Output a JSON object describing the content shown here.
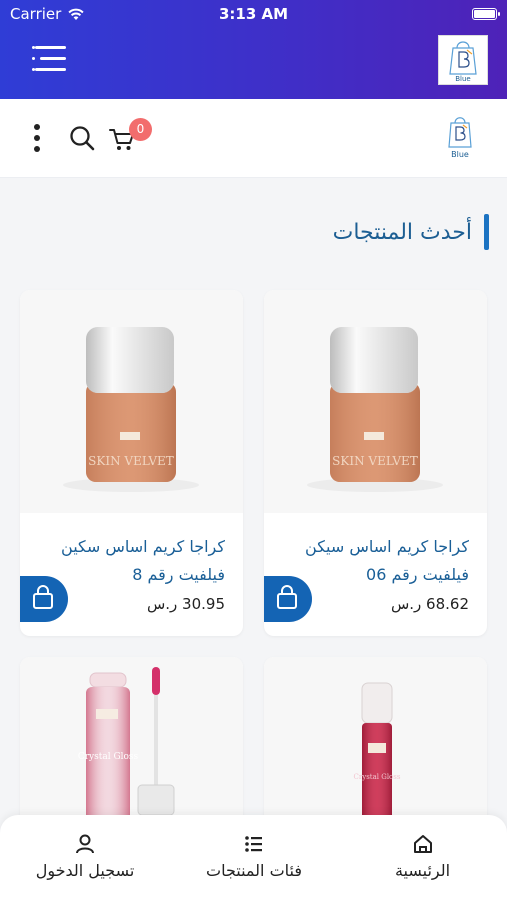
{
  "status_bar": {
    "carrier": "Carrier",
    "time": "3:13 AM"
  },
  "app_bar": {
    "logo_text": "Blue"
  },
  "header": {
    "cart_count": "0",
    "logo_text": "Blue"
  },
  "section": {
    "title": "أحدث المنتجات"
  },
  "products": [
    {
      "name": "كراجا كريم اساس سيكن فيلفيت رقم 06",
      "price": "68.62 ر.س",
      "jar_label": "SKIN VELVET"
    },
    {
      "name": "كراجا كريم اساس سكين فيلفيت رقم 8",
      "price": "30.95 ر.س",
      "jar_label": "SKIN VELVET"
    },
    {
      "jar_label": "Crystal Gloss"
    },
    {
      "jar_label": "Crystal Gloss"
    }
  ],
  "bottom_nav": {
    "home": "الرئيسية",
    "categories": "فئات المنتجات",
    "login": "تسجيل الدخول"
  },
  "colors": {
    "primary": "#1464b4",
    "app_bar_start": "#2f3dd6",
    "app_bar_end": "#4e22b8",
    "badge": "#f26d6d"
  }
}
